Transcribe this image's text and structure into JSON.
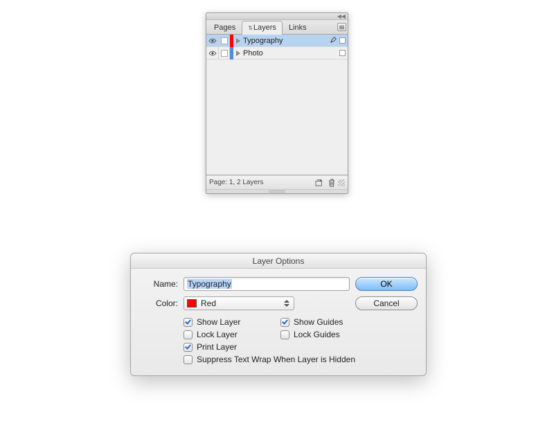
{
  "panel": {
    "tabs": {
      "pages": "Pages",
      "layers": "Layers",
      "links": "Links"
    },
    "layers": [
      {
        "name": "Typography",
        "color": "#ff0000",
        "selected": true,
        "visible": true,
        "active_pen": true
      },
      {
        "name": "Photo",
        "color": "#4e8ed6",
        "selected": false,
        "visible": true,
        "active_pen": false
      }
    ],
    "status": "Page: 1, 2 Layers"
  },
  "dialog": {
    "title": "Layer Options",
    "name_label": "Name:",
    "name_value": "Typography",
    "color_label": "Color:",
    "color_name": "Red",
    "color_hex": "#ff0000",
    "ok": "OK",
    "cancel": "Cancel",
    "checks": {
      "show_layer": {
        "label": "Show Layer",
        "checked": true
      },
      "show_guides": {
        "label": "Show Guides",
        "checked": true
      },
      "lock_layer": {
        "label": "Lock Layer",
        "checked": false
      },
      "lock_guides": {
        "label": "Lock Guides",
        "checked": false
      },
      "print_layer": {
        "label": "Print Layer",
        "checked": true
      },
      "suppress": {
        "label": "Suppress Text Wrap When Layer is Hidden",
        "checked": false
      }
    }
  }
}
